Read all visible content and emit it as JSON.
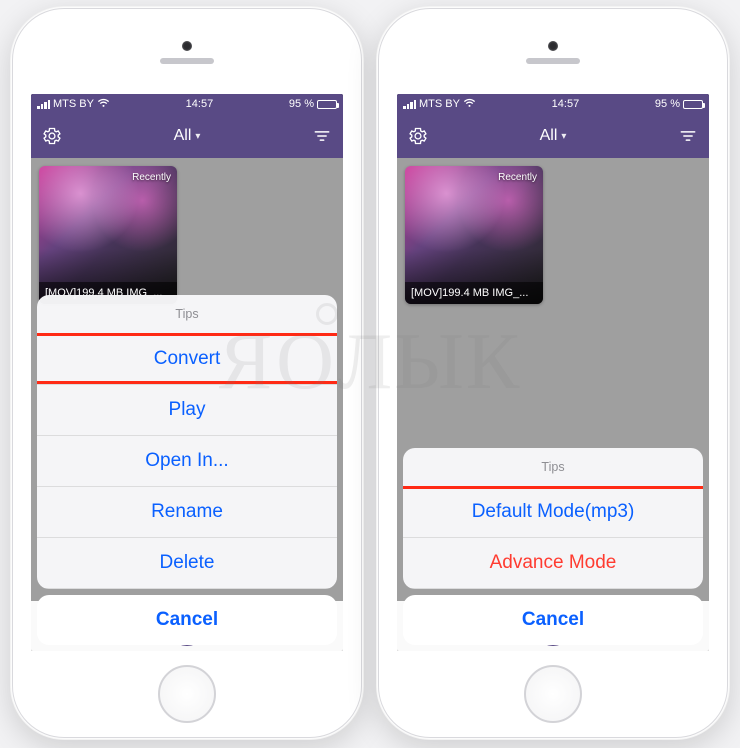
{
  "status_bar": {
    "carrier": "MTS BY",
    "time": "14:57",
    "battery_pct": "95 %"
  },
  "nav": {
    "title": "All",
    "gear_icon": "settings",
    "filter_icon": "filter"
  },
  "thumbnail": {
    "badge": "Recently",
    "label": "[MOV]199.4 MB IMG_..."
  },
  "sheet_left": {
    "header": "Tips",
    "items": [
      {
        "label": "Convert",
        "destructive": false
      },
      {
        "label": "Play",
        "destructive": false
      },
      {
        "label": "Open In...",
        "destructive": false
      },
      {
        "label": "Rename",
        "destructive": false
      },
      {
        "label": "Delete",
        "destructive": false
      }
    ],
    "cancel": "Cancel",
    "highlight_idx": 0
  },
  "sheet_right": {
    "header": "Tips",
    "items": [
      {
        "label": "Default Mode(mp3)",
        "destructive": false
      },
      {
        "label": "Advance Mode",
        "destructive": true
      }
    ],
    "cancel": "Cancel",
    "highlight_all": true
  },
  "watermark": {
    "text_prefix": "Я",
    "text_mid": "О",
    "text_suffix": "ЛЫК"
  }
}
